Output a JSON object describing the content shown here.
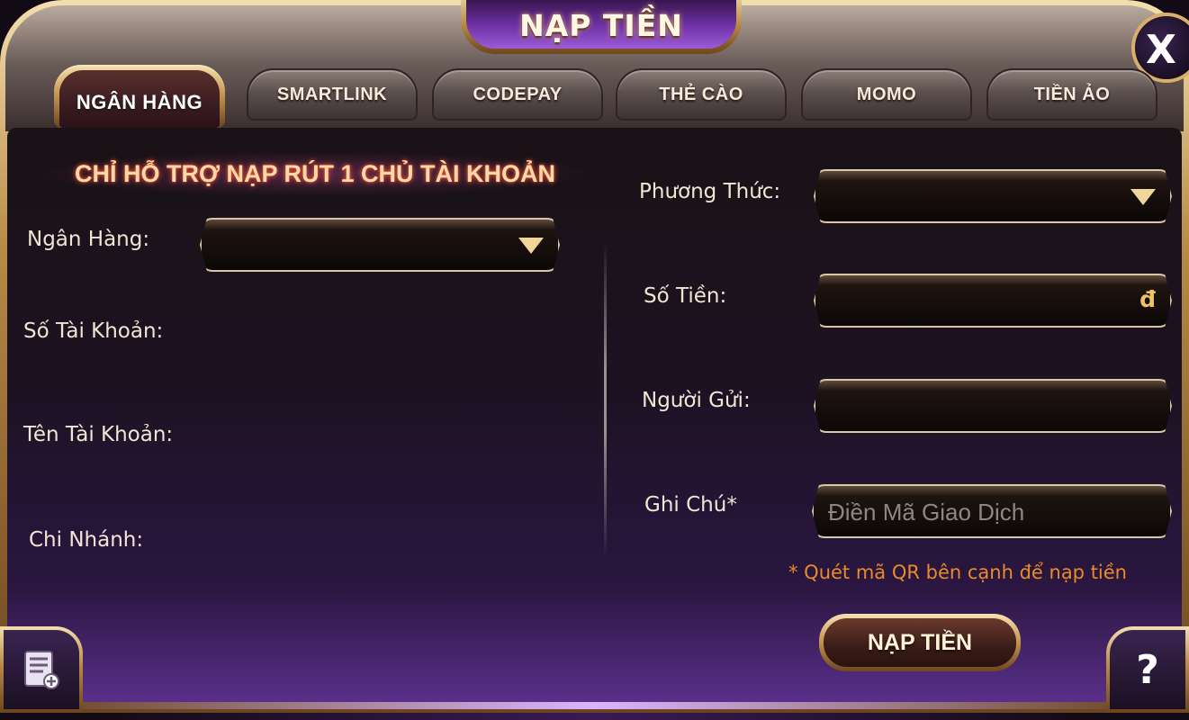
{
  "dialog": {
    "title": "NẠP TIỀN",
    "close_label": "X"
  },
  "tabs": [
    {
      "label": "NGÂN HÀNG",
      "active": true
    },
    {
      "label": "SMARTLINK",
      "active": false
    },
    {
      "label": "CODEPAY",
      "active": false
    },
    {
      "label": "THẺ CÀO",
      "active": false
    },
    {
      "label": "MOMO",
      "active": false
    },
    {
      "label": "TIỀN ẢO",
      "active": false
    }
  ],
  "left": {
    "headline": "CHỈ HỖ TRỢ NẠP RÚT 1 CHỦ TÀI KHOẢN",
    "bank_label": "Ngân Hàng:",
    "bank_value": "",
    "account_number_label": "Số Tài Khoản:",
    "account_name_label": "Tên Tài Khoản:",
    "branch_label": "Chi Nhánh:"
  },
  "right": {
    "method_label": "Phương Thức:",
    "method_value": "",
    "amount_label": "Số Tiền:",
    "amount_unit": "đ",
    "sender_label": "Người Gửi:",
    "note_label": "Ghi Chú*",
    "note_placeholder": "Điền Mã Giao Dịch",
    "hint": "* Quét mã QR bên cạnh để nạp tiền",
    "submit_label": "NẠP TIỀN"
  },
  "corners": {
    "help_glyph": "?"
  },
  "colors": {
    "gold": "#d9b06a",
    "purple": "#6b2fa0",
    "hint_orange": "#e98b2a",
    "headline": "#ffd9a8"
  }
}
